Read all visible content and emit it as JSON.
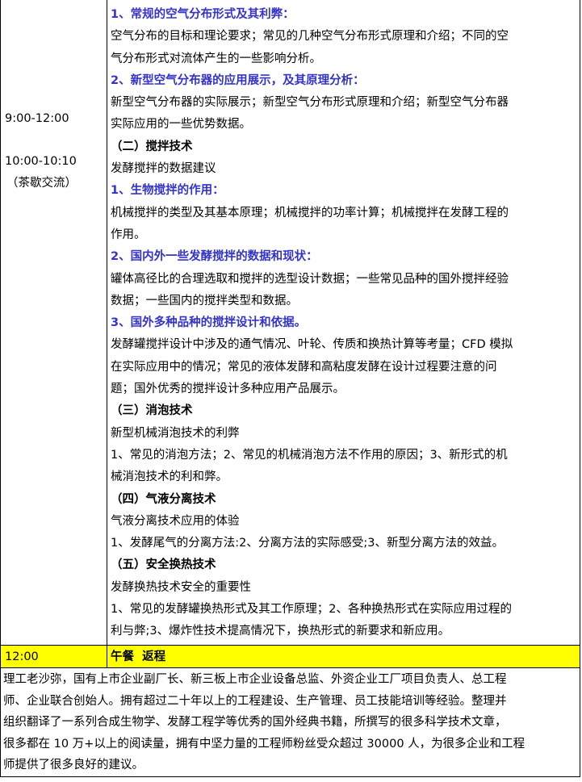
{
  "schedule": {
    "time_main": "9:00-12:00",
    "time_break": "10:00-10:10",
    "break_label": "（茶歇交流）",
    "content": [
      {
        "kind": "blue",
        "text": "1、常规的空气分布形式及其利弊："
      },
      {
        "kind": "normal",
        "text": "空气分布的目标和理论要求；常见的几种空气分布形式原理和介绍；不同的空"
      },
      {
        "kind": "normal",
        "text": "气分布形式对流体产生的一些影响分析。"
      },
      {
        "kind": "blue",
        "text": "2、新型空气分布器的应用展示，及其原理分析："
      },
      {
        "kind": "normal",
        "text": "新型空气分布器的实际展示；新型空气分布形式原理和介绍；新型空气分布器"
      },
      {
        "kind": "normal",
        "text": "实际应用的一些优势数据。"
      },
      {
        "kind": "bold",
        "text": "（二）搅拌技术"
      },
      {
        "kind": "normal",
        "text": "发酵搅拌的数据建议"
      },
      {
        "kind": "blue",
        "text": "1、生物搅拌的作用："
      },
      {
        "kind": "normal",
        "text": "机械搅拌的类型及其基本原理；机械搅拌的功率计算；机械搅拌在发酵工程的"
      },
      {
        "kind": "normal",
        "text": "作用。"
      },
      {
        "kind": "blue",
        "text": "2、国内外一些发酵搅拌的数据和现状："
      },
      {
        "kind": "normal",
        "text": "罐体高径比的合理选取和搅拌的选型设计数据；一些常见品种的国外搅拌经验"
      },
      {
        "kind": "normal",
        "text": "数据；一些国内的搅拌类型和数据。"
      },
      {
        "kind": "blue",
        "text": "3、国外多种品种的搅拌设计和依据。"
      },
      {
        "kind": "normal",
        "text": "发酵罐搅拌设计中涉及的通气情况、叶轮、传质和换热计算等考量；CFD 模拟"
      },
      {
        "kind": "normal",
        "text": "在实际应用中的情况；常见的液体发酵和高粘度发酵在设计过程要注意的问"
      },
      {
        "kind": "normal",
        "text": "题；国外优秀的搅拌设计多种应用产品展示。"
      },
      {
        "kind": "bold",
        "text": "（三）消泡技术"
      },
      {
        "kind": "normal",
        "text": "新型机械消泡技术的利弊"
      },
      {
        "kind": "normal",
        "text": "1、常见的消泡方法；2、常见的机械消泡方法不作用的原因；3、新形式的机"
      },
      {
        "kind": "normal",
        "text": "械消泡技术的利和弊。"
      },
      {
        "kind": "bold",
        "text": "（四）气液分离技术"
      },
      {
        "kind": "normal",
        "text": "气液分离技术应用的体验"
      },
      {
        "kind": "normal",
        "text": "1、发酵尾气的分离方法:2、分离方法的实际感受;3、新型分离方法的效益。"
      },
      {
        "kind": "bold",
        "text": "（五）安全换热技术"
      },
      {
        "kind": "normal",
        "text": "发酵换热技术安全的重要性"
      },
      {
        "kind": "normal",
        "text": "1、常见的发酵罐换热形式及其工作原理；2、各种换热形式在实际应用过程的"
      },
      {
        "kind": "normal",
        "text": "利与弊;3、爆炸性技术提高情况下，换热形式的新要求和新应用。"
      }
    ]
  },
  "lunch": {
    "time": "12:00",
    "label": "午餐  返程"
  },
  "bio": {
    "lines": [
      "理工老沙弥，国有上市企业副厂长、新三板上市企业设备总监、外资企业工厂项目负责人、总工程",
      "师、企业联合创始人。拥有超过二十年以上的工程建设、生产管理、员工技能培训等经验。整理并",
      "组织翻译了一系列合成生物学、发酵工程学等优秀的国外经典书籍，所撰写的很多科学技术文章，",
      "很多都在 10 万+以上的阅读量，拥有中坚力量的工程师粉丝受众超过 30000 人，为很多企业和工程",
      "师提供了很多良好的建议。"
    ]
  },
  "colors": {
    "heading_blue": "#3333cc",
    "highlight_yellow": "#ffff00",
    "border": "#000000"
  }
}
